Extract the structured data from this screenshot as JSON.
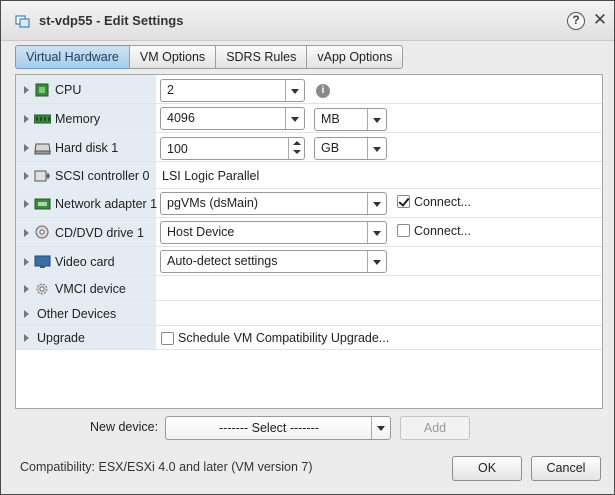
{
  "window": {
    "title": "st-vdp55 - Edit Settings",
    "help_label": "?",
    "close_label": "✕"
  },
  "tabs": [
    {
      "label": "Virtual Hardware",
      "active": true
    },
    {
      "label": "VM Options",
      "active": false
    },
    {
      "label": "SDRS Rules",
      "active": false
    },
    {
      "label": "vApp Options",
      "active": false
    }
  ],
  "hardware": {
    "cpu": {
      "label": "CPU",
      "value": "2",
      "icon": "cpu-icon"
    },
    "memory": {
      "label": "Memory",
      "value": "4096",
      "unit": "MB",
      "icon": "memory-icon"
    },
    "hard_disk": {
      "label": "Hard disk 1",
      "value": "100",
      "unit": "GB",
      "icon": "hard-disk-icon"
    },
    "scsi": {
      "label": "SCSI controller 0",
      "value": "LSI Logic Parallel",
      "icon": "scsi-icon"
    },
    "network": {
      "label": "Network adapter 1",
      "value": "pgVMs (dsMain)",
      "connect_label": "Connect...",
      "connected": true,
      "icon": "network-icon"
    },
    "cdrom": {
      "label": "CD/DVD drive 1",
      "value": "Host Device",
      "connect_label": "Connect...",
      "connected": false,
      "icon": "cd-dvd-icon"
    },
    "video": {
      "label": "Video card",
      "value": "Auto-detect settings",
      "icon": "video-card-icon"
    },
    "vmci": {
      "label": "VMCI device",
      "icon": "vmci-icon"
    },
    "other": {
      "label": "Other Devices"
    },
    "upgrade": {
      "label": "Upgrade",
      "checkbox_label": "Schedule VM Compatibility Upgrade...",
      "checked": false
    }
  },
  "footer": {
    "new_device_label": "New device:",
    "new_device_select": "------- Select -------",
    "add_label": "Add",
    "compatibility": "Compatibility: ESX/ESXi 4.0 and later (VM version 7)",
    "ok_label": "OK",
    "cancel_label": "Cancel"
  },
  "colors": {
    "active_tab": "#a9cbe9",
    "label_column": "#e4ebf2"
  }
}
